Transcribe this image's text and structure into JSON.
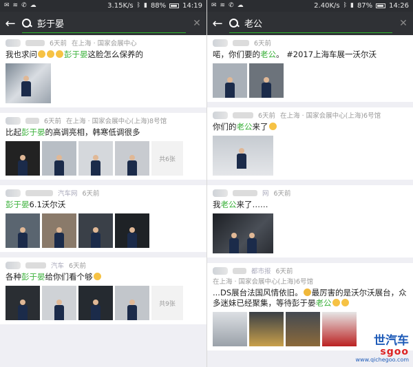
{
  "left": {
    "status": {
      "speed": "3.15K/s",
      "battery": "88%",
      "time": "14:19"
    },
    "search": {
      "query": "彭于晏"
    },
    "posts": [
      {
        "time": "6天前",
        "location": "在上海 · 国家会展中心",
        "text_pre": "我也求问",
        "highlight": "彭于晏",
        "text_post": "这脸怎么保养的",
        "source": ""
      },
      {
        "time": "6天前",
        "location": "在上海 · 国家会展中心(上海)8号馆",
        "text_pre": "比起",
        "highlight": "彭于晏",
        "text_post": "的高调亮相，韩寒低调很多",
        "more": "共6张",
        "source": ""
      },
      {
        "time": "6天前",
        "location": "",
        "text_pre": "",
        "highlight": "彭于晏",
        "text_post": "6.1沃尔沃",
        "source": "汽车网"
      },
      {
        "time": "6天前",
        "location": "",
        "text_pre": "各种",
        "highlight": "彭于晏",
        "text_post": "给你们看个够",
        "more": "共9张",
        "source": "汽车"
      }
    ]
  },
  "right": {
    "status": {
      "speed": "2.40K/s",
      "battery": "87%",
      "time": "14:26"
    },
    "search": {
      "query": "老公"
    },
    "posts": [
      {
        "time": "6天前",
        "location": "",
        "text_pre": "喏，你们要的",
        "highlight": "老公",
        "text_post": "。 #2017上海车展一沃尔沃"
      },
      {
        "time": "6天前",
        "location": "在上海 · 国家会展中心(上海)6号馆",
        "text_pre": "你们的",
        "highlight": "老公",
        "text_post": "来了"
      },
      {
        "time": "6天前",
        "location": "",
        "text_pre": "我",
        "highlight": "老公",
        "text_post": "来了……",
        "source": "网"
      },
      {
        "time": "6天前",
        "location": "在上海 · 国家会展中心(上海)6号馆",
        "source": "都市报",
        "text_pre": "...DS展台法国风情依旧。",
        "text_mid": "最厉害的是沃尔沃展台，众多迷妹已经聚集，等待彭于晏",
        "highlight": "老公",
        "text_post": ""
      }
    ]
  },
  "watermark": {
    "line1": "世汽车",
    "line2": "sgoo",
    "line3": "www.qichegoo.com"
  }
}
